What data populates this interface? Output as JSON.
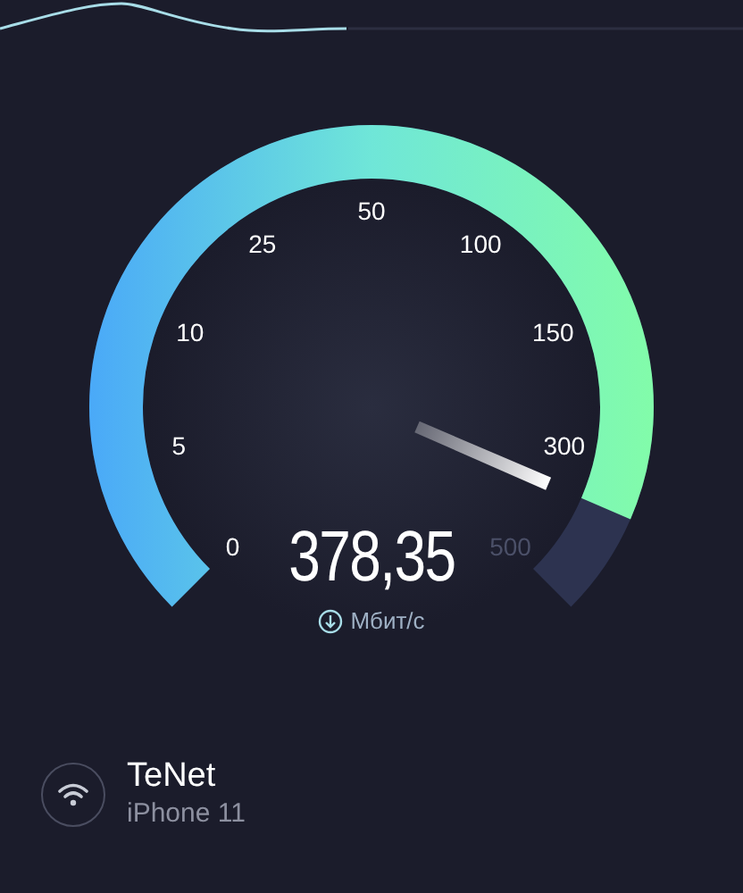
{
  "gauge": {
    "scale_labels": [
      "0",
      "5",
      "10",
      "25",
      "50",
      "100",
      "150",
      "300",
      "500"
    ],
    "reading": "378,35",
    "unit": "Мбит/с"
  },
  "connection": {
    "name": "TeNet",
    "device": "iPhone 11"
  }
}
